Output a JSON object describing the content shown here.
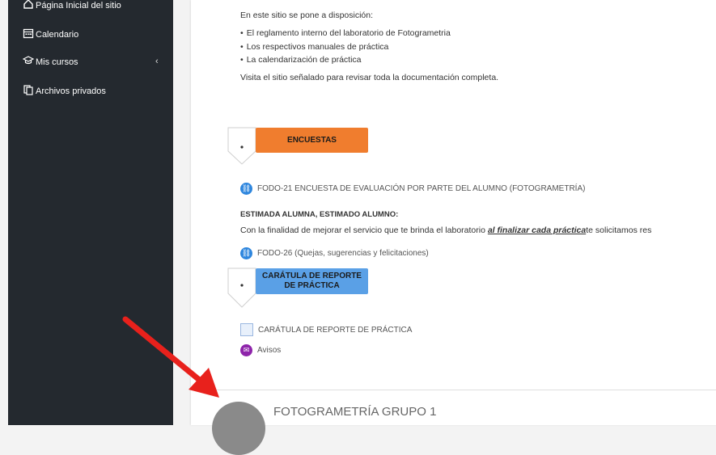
{
  "sidebar": {
    "items": [
      {
        "label": "Página Inicial del sitio",
        "icon": "home-icon"
      },
      {
        "label": "Calendario",
        "icon": "calendar-icon"
      },
      {
        "label": "Mis cursos",
        "icon": "graduation-cap-icon"
      },
      {
        "label": "Archivos privados",
        "icon": "file-icon"
      }
    ]
  },
  "content": {
    "intro": "En este sitio se pone a disposición:",
    "bullets": [
      "El reglamento interno del laboratorio de Fotogrametria",
      "Los respectivos manuales de práctica",
      "La calendarización  de práctica"
    ],
    "visit_text": "Visita el sitio señalado para revisar toda la documentación completa.",
    "section_encuestas": "ENCUESTAS",
    "link_fodo21": "FODO-21 ENCUESTA DE EVALUACIÓN POR PARTE DEL ALUMNO (FOTOGRAMETRÍA)",
    "estimada_heading": "ESTIMADA ALUMNA, ESTIMADO ALUMNO:",
    "finalidad_before": "Con la finalidad de mejorar el servicio  que te brinda el laboratorio ",
    "finalidad_emph": "al finalizar cada práctica",
    "finalidad_after": "te solicitamos res",
    "link_fodo26": "FODO-26 (Quejas, sugerencias y felicitaciones)",
    "section_caratula_line1": "CARÁTULA DE REPORTE",
    "section_caratula_line2": "DE PRÁCTICA",
    "link_caratula": "CARÁTULA DE REPORTE DE PRÁCTICA",
    "link_avisos": "Avisos",
    "course_title": "FOTOGRAMETRÍA GRUPO 1"
  },
  "colors": {
    "sidebar_bg": "#24292f",
    "encuestas_banner": "#f07d2e",
    "caratula_banner": "#5aa0e6",
    "link_icon": "#2e86de",
    "avisos_icon": "#8e24aa",
    "arrow": "#e8211c"
  }
}
